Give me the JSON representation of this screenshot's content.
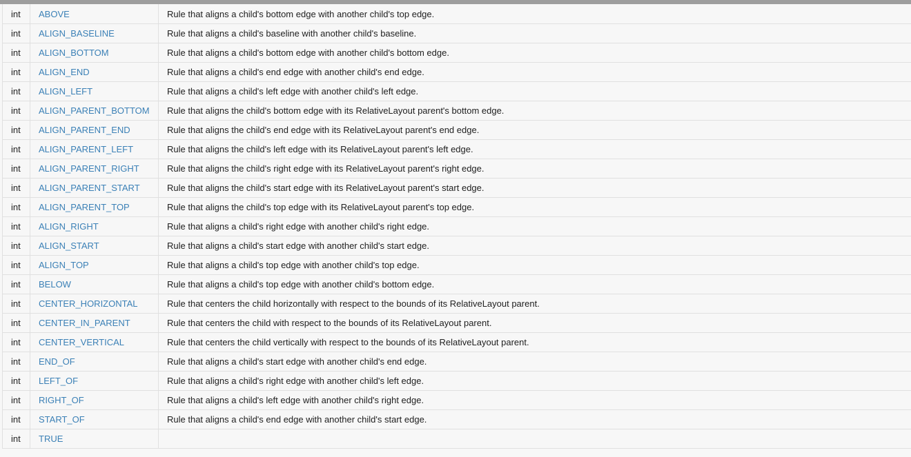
{
  "rows": [
    {
      "type": "int",
      "name": "ABOVE",
      "desc": "Rule that aligns a child's bottom edge with another child's top edge."
    },
    {
      "type": "int",
      "name": "ALIGN_BASELINE",
      "desc": "Rule that aligns a child's baseline with another child's baseline."
    },
    {
      "type": "int",
      "name": "ALIGN_BOTTOM",
      "desc": "Rule that aligns a child's bottom edge with another child's bottom edge."
    },
    {
      "type": "int",
      "name": "ALIGN_END",
      "desc": "Rule that aligns a child's end edge with another child's end edge."
    },
    {
      "type": "int",
      "name": "ALIGN_LEFT",
      "desc": "Rule that aligns a child's left edge with another child's left edge."
    },
    {
      "type": "int",
      "name": "ALIGN_PARENT_BOTTOM",
      "desc": "Rule that aligns the child's bottom edge with its RelativeLayout parent's bottom edge."
    },
    {
      "type": "int",
      "name": "ALIGN_PARENT_END",
      "desc": "Rule that aligns the child's end edge with its RelativeLayout parent's end edge."
    },
    {
      "type": "int",
      "name": "ALIGN_PARENT_LEFT",
      "desc": "Rule that aligns the child's left edge with its RelativeLayout parent's left edge."
    },
    {
      "type": "int",
      "name": "ALIGN_PARENT_RIGHT",
      "desc": "Rule that aligns the child's right edge with its RelativeLayout parent's right edge."
    },
    {
      "type": "int",
      "name": "ALIGN_PARENT_START",
      "desc": "Rule that aligns the child's start edge with its RelativeLayout parent's start edge."
    },
    {
      "type": "int",
      "name": "ALIGN_PARENT_TOP",
      "desc": "Rule that aligns the child's top edge with its RelativeLayout parent's top edge."
    },
    {
      "type": "int",
      "name": "ALIGN_RIGHT",
      "desc": "Rule that aligns a child's right edge with another child's right edge."
    },
    {
      "type": "int",
      "name": "ALIGN_START",
      "desc": "Rule that aligns a child's start edge with another child's start edge."
    },
    {
      "type": "int",
      "name": "ALIGN_TOP",
      "desc": "Rule that aligns a child's top edge with another child's top edge."
    },
    {
      "type": "int",
      "name": "BELOW",
      "desc": "Rule that aligns a child's top edge with another child's bottom edge."
    },
    {
      "type": "int",
      "name": "CENTER_HORIZONTAL",
      "desc": "Rule that centers the child horizontally with respect to the bounds of its RelativeLayout parent."
    },
    {
      "type": "int",
      "name": "CENTER_IN_PARENT",
      "desc": "Rule that centers the child with respect to the bounds of its RelativeLayout parent."
    },
    {
      "type": "int",
      "name": "CENTER_VERTICAL",
      "desc": "Rule that centers the child vertically with respect to the bounds of its RelativeLayout parent."
    },
    {
      "type": "int",
      "name": "END_OF",
      "desc": "Rule that aligns a child's start edge with another child's end edge."
    },
    {
      "type": "int",
      "name": "LEFT_OF",
      "desc": "Rule that aligns a child's right edge with another child's left edge."
    },
    {
      "type": "int",
      "name": "RIGHT_OF",
      "desc": "Rule that aligns a child's left edge with another child's right edge."
    },
    {
      "type": "int",
      "name": "START_OF",
      "desc": "Rule that aligns a child's end edge with another child's start edge."
    },
    {
      "type": "int",
      "name": "TRUE",
      "desc": ""
    }
  ],
  "colors": {
    "link": "#3b80b6",
    "text": "#212121",
    "border": "#e0e0e0",
    "background": "#f7f7f7",
    "top_bar": "#9e9e9e"
  }
}
